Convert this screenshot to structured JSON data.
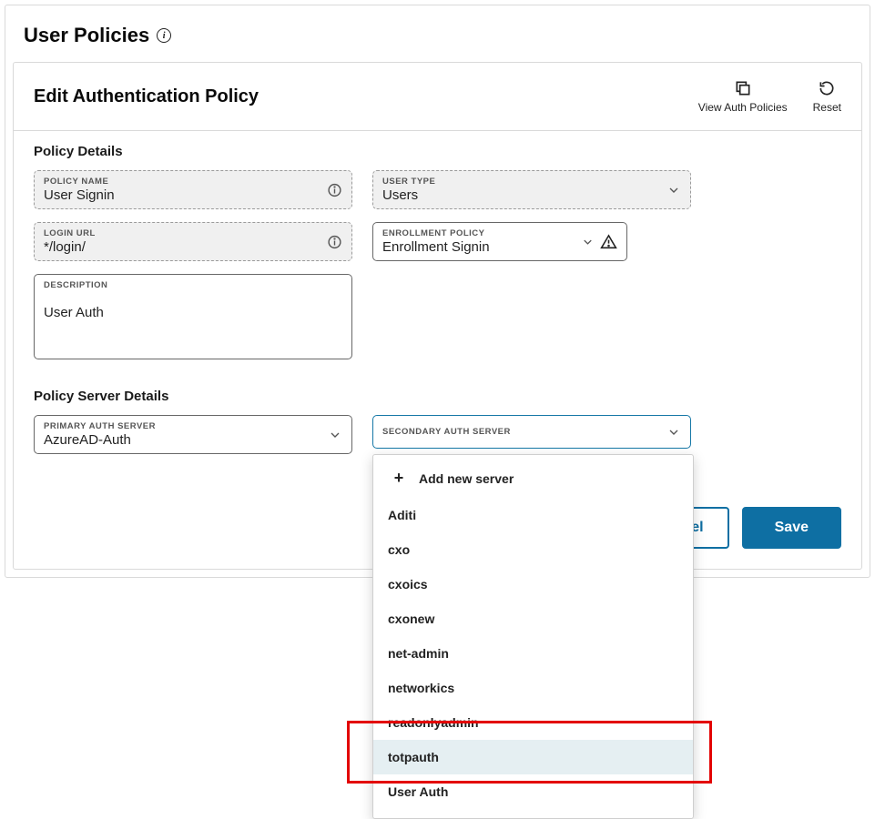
{
  "header": {
    "title": "User Policies"
  },
  "panel": {
    "title": "Edit Authentication Policy",
    "actions": {
      "view": "View Auth Policies",
      "reset": "Reset"
    }
  },
  "sections": {
    "details": {
      "title": "Policy Details",
      "policy_name": {
        "label": "POLICY NAME",
        "value": "User Signin"
      },
      "user_type": {
        "label": "USER TYPE",
        "value": "Users"
      },
      "login_url": {
        "label": "LOGIN URL",
        "value": "*/login/"
      },
      "enrollment": {
        "label": "ENROLLMENT POLICY",
        "value": "Enrollment Signin"
      },
      "description": {
        "label": "DESCRIPTION",
        "value": "User Auth"
      }
    },
    "server": {
      "title": "Policy Server Details",
      "primary": {
        "label": "PRIMARY AUTH SERVER",
        "value": "AzureAD-Auth"
      },
      "secondary": {
        "label": "SECONDARY AUTH SERVER",
        "value": ""
      }
    }
  },
  "dropdown": {
    "add_label": "Add new server",
    "items": [
      "Aditi",
      "cxo",
      "cxoics",
      "cxonew",
      "net-admin",
      "networkics",
      "readonlyadmin",
      "totpauth",
      "User Auth"
    ],
    "highlighted_index": 7
  },
  "buttons": {
    "cancel": "Cancel",
    "save": "Save"
  }
}
